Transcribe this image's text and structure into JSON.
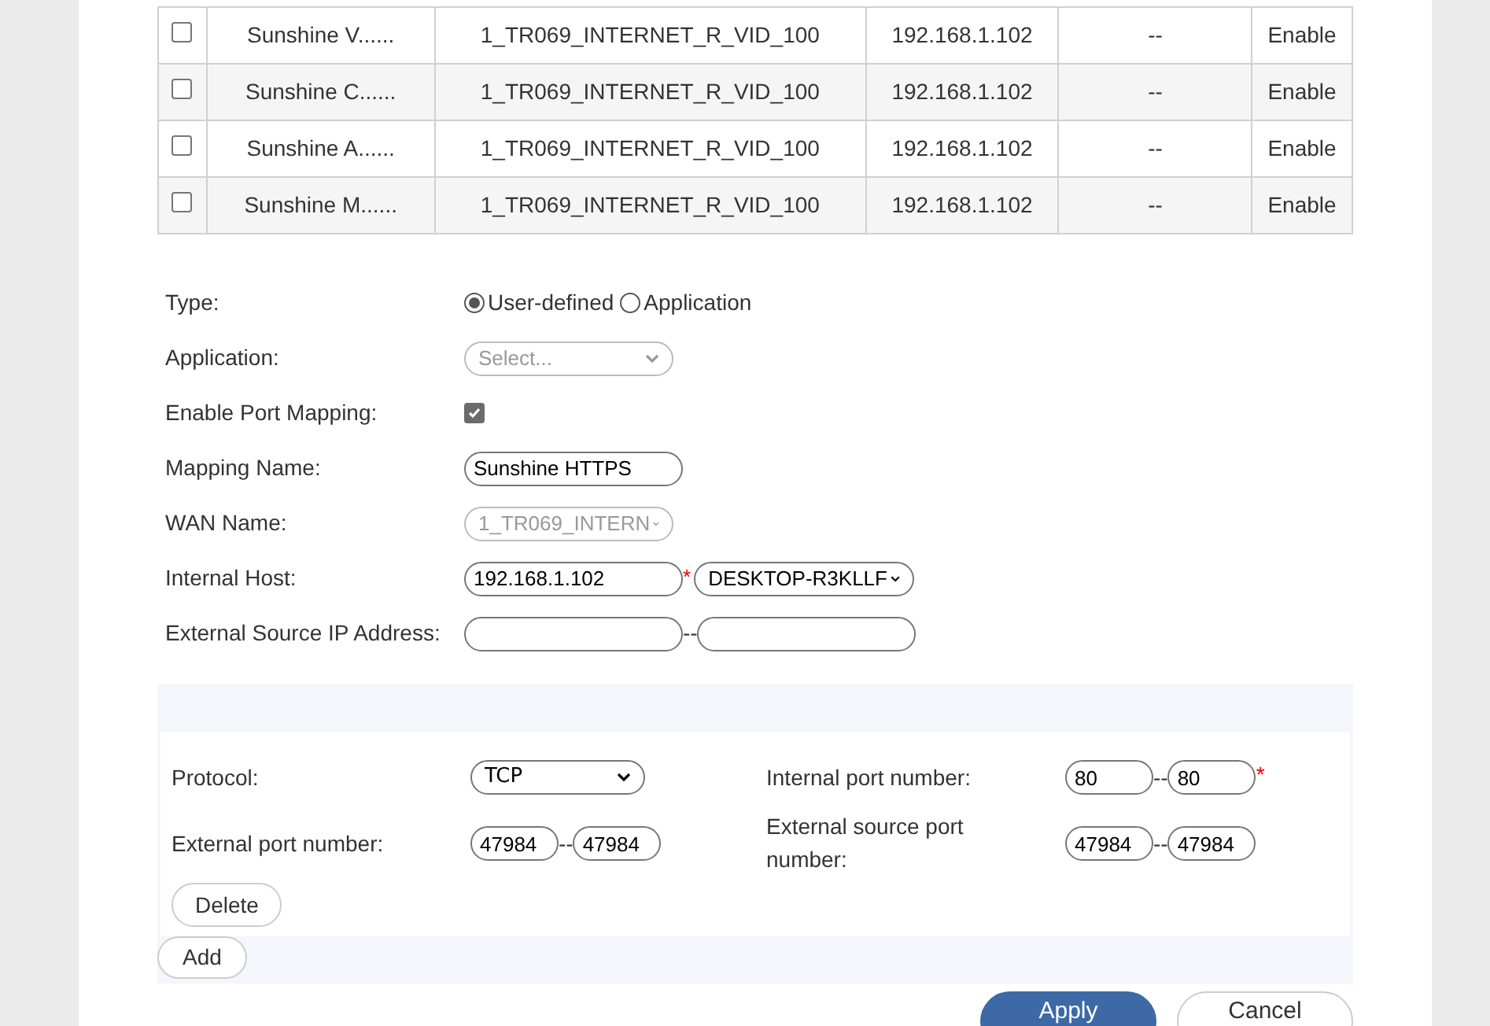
{
  "table": {
    "rows": [
      {
        "checked": false,
        "name": "Sunshine V......",
        "wan": "1_TR069_INTERNET_R_VID_100",
        "host": "192.168.1.102",
        "source": "--",
        "status": "Enable"
      },
      {
        "checked": false,
        "name": "Sunshine C......",
        "wan": "1_TR069_INTERNET_R_VID_100",
        "host": "192.168.1.102",
        "source": "--",
        "status": "Enable"
      },
      {
        "checked": false,
        "name": "Sunshine A......",
        "wan": "1_TR069_INTERNET_R_VID_100",
        "host": "192.168.1.102",
        "source": "--",
        "status": "Enable"
      },
      {
        "checked": false,
        "name": "Sunshine M......",
        "wan": "1_TR069_INTERNET_R_VID_100",
        "host": "192.168.1.102",
        "source": "--",
        "status": "Enable"
      }
    ]
  },
  "form": {
    "type": {
      "label": "Type:",
      "options": [
        {
          "label": "User-defined",
          "selected": true
        },
        {
          "label": "Application",
          "selected": false
        }
      ]
    },
    "application": {
      "label": "Application:",
      "value": "Select...",
      "disabled": true
    },
    "enable": {
      "label": "Enable Port Mapping:",
      "checked": true
    },
    "mapping_name": {
      "label": "Mapping Name:",
      "value": "Sunshine HTTPS"
    },
    "wan_name": {
      "label": "WAN Name:",
      "value": "1_TR069_INTERN",
      "disabled": true
    },
    "internal_host": {
      "label": "Internal Host:",
      "value": "192.168.1.102",
      "required": "*",
      "device": "DESKTOP-R3KLLF"
    },
    "external_source_ip": {
      "label": "External Source IP Address:",
      "separator": "--"
    }
  },
  "port_rule": {
    "protocol": {
      "label": "Protocol:",
      "value": "TCP"
    },
    "internal_port": {
      "label": "Internal port number:",
      "from": "80",
      "separator": "--",
      "to": "80",
      "required": "*"
    },
    "external_port": {
      "label": "External port number:",
      "from": "47984",
      "separator": "--",
      "to": "47984"
    },
    "external_source_port": {
      "label": "External source port number:",
      "from": "47984",
      "separator": "--",
      "to": "47984"
    },
    "delete": "Delete"
  },
  "add": "Add",
  "buttons": [
    {
      "label": "Apply",
      "kind": "primary"
    },
    {
      "label": "Cancel",
      "kind": "secondary"
    }
  ]
}
